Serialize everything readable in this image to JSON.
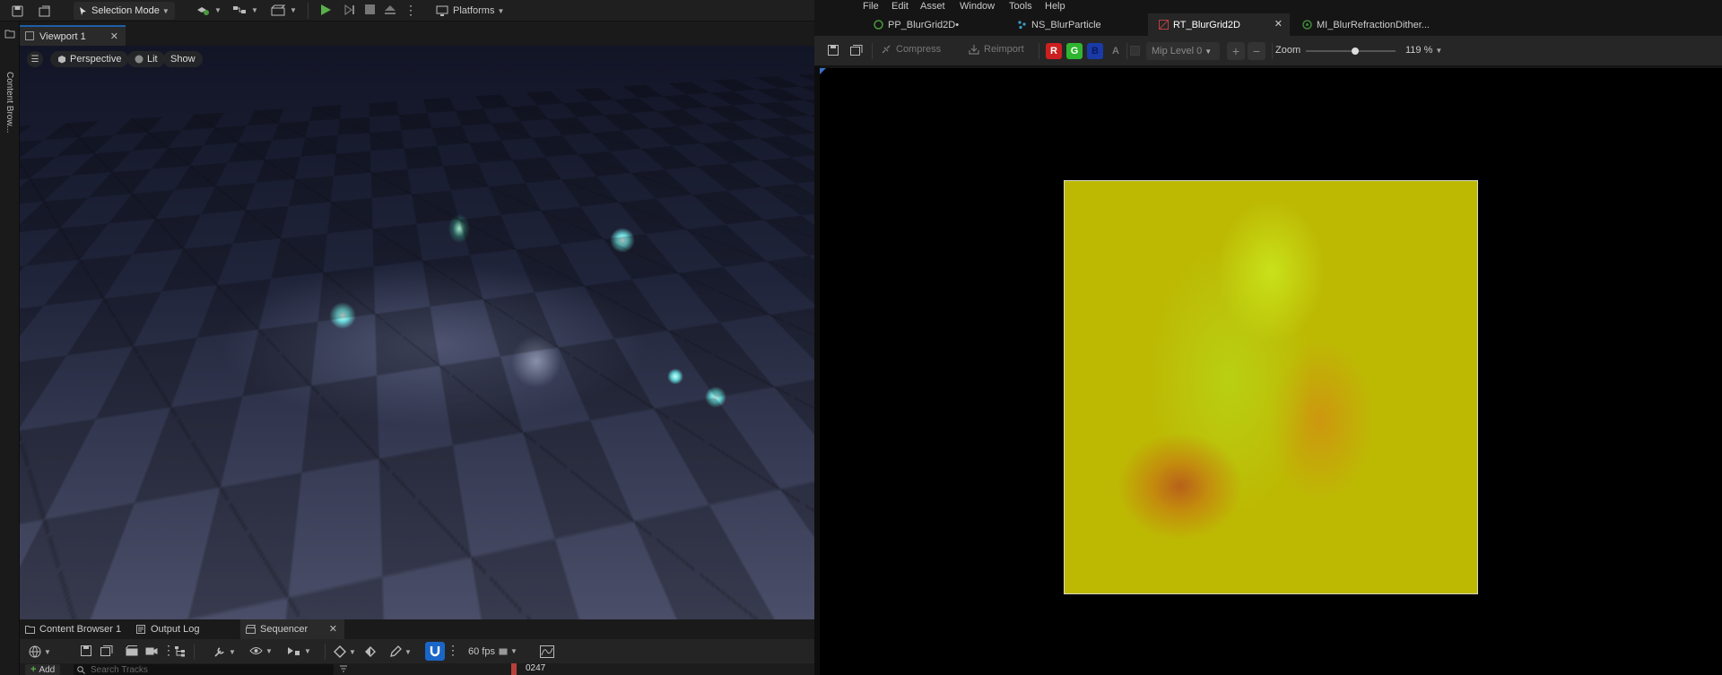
{
  "left_toolbar": {
    "selection_mode": "Selection Mode",
    "platforms": "Platforms"
  },
  "content_drawer": {
    "label": "Content Brow..."
  },
  "viewport": {
    "tab_label": "Viewport 1",
    "perspective": "Perspective",
    "lit": "Lit",
    "show": "Show"
  },
  "bottom_tabs": [
    {
      "label": "Content Browser 1"
    },
    {
      "label": "Output Log"
    },
    {
      "label": "Sequencer"
    }
  ],
  "sequencer": {
    "fps": "60 fps",
    "add_label": "Add",
    "search_placeholder": "Search Tracks",
    "frame": "0247"
  },
  "right_menu": [
    "File",
    "Edit",
    "Asset",
    "Window",
    "Tools",
    "Help"
  ],
  "right_tabs": [
    {
      "label": "PP_BlurGrid2D•"
    },
    {
      "label": "NS_BlurParticle"
    },
    {
      "label": "RT_BlurGrid2D"
    },
    {
      "label": "MI_BlurRefractionDither..."
    }
  ],
  "texture_toolbar": {
    "compress": "Compress",
    "reimport": "Reimport",
    "channels": {
      "r": "R",
      "g": "G",
      "b": "B",
      "a": "A"
    },
    "mip_level": "Mip Level 0",
    "zoom_label": "Zoom",
    "zoom_value": "119 %",
    "zoom_fraction": 0.55
  },
  "colors": {
    "accent": "#1f5ea8",
    "play": "#5ab04a",
    "channel_r": "#cc1f1f",
    "channel_g": "#2fb52f",
    "channel_b": "#1a3aa8",
    "texture_base": "#bdb903"
  }
}
